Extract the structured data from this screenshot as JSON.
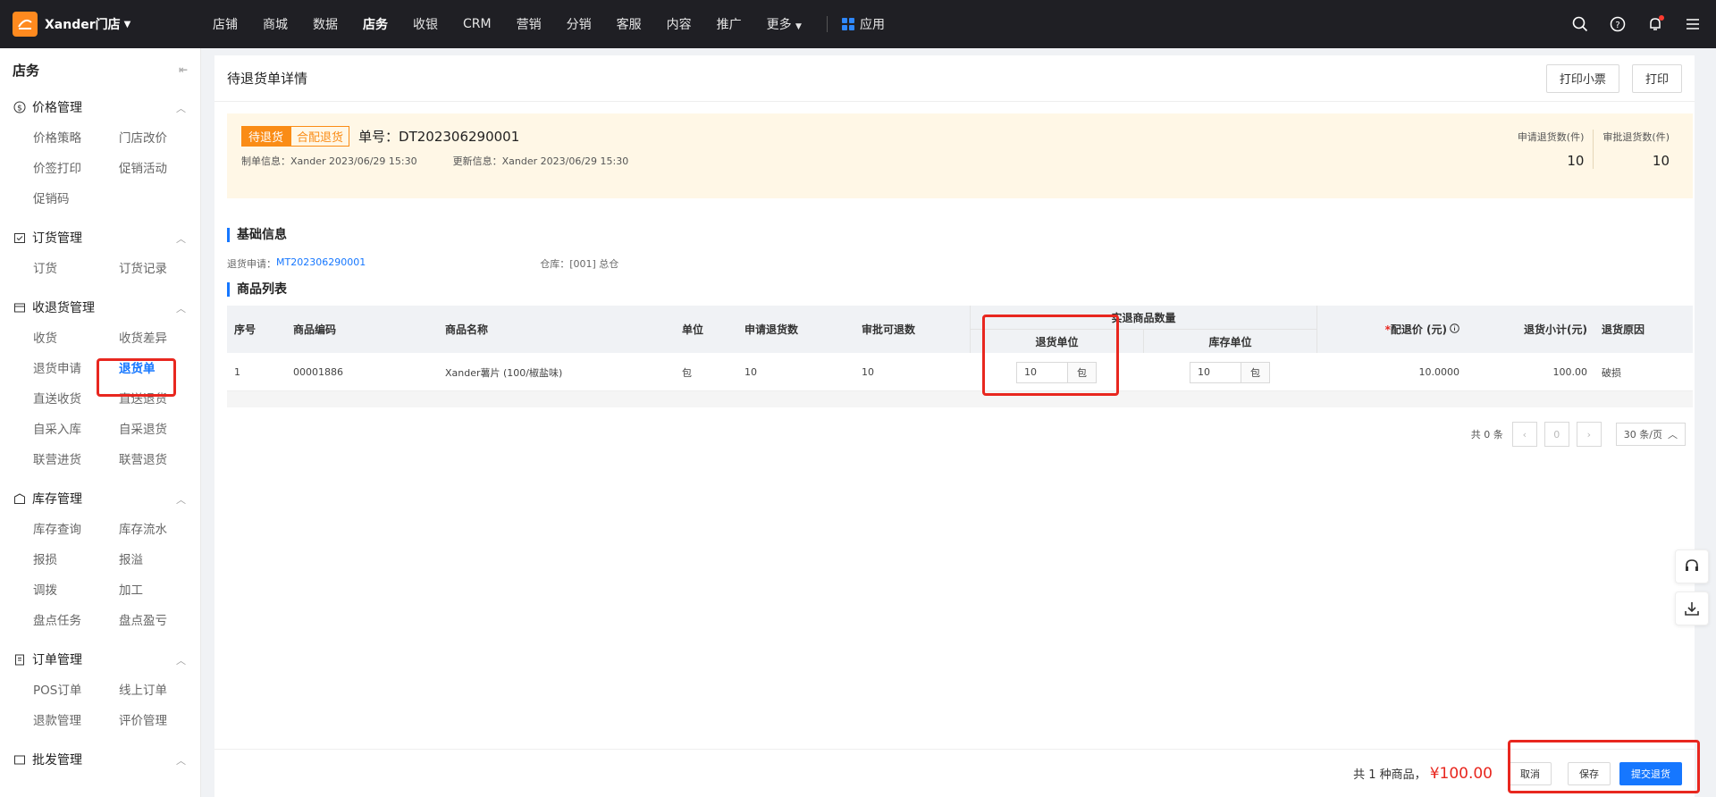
{
  "topbar": {
    "store": "Xander门店",
    "nav": [
      "店铺",
      "商城",
      "数据",
      "店务",
      "收银",
      "CRM",
      "营销",
      "分销",
      "客服",
      "内容",
      "推广",
      "更多"
    ],
    "active_nav": "店务",
    "app": "应用"
  },
  "sidebar": {
    "title": "店务",
    "groups": [
      {
        "title": "价格管理",
        "items": [
          "价格策略",
          "门店改价",
          "价签打印",
          "促销活动",
          "促销码"
        ]
      },
      {
        "title": "订货管理",
        "items": [
          "订货",
          "订货记录"
        ]
      },
      {
        "title": "收退货管理",
        "items": [
          "收货",
          "收货差异",
          "退货申请",
          "退货单",
          "直送收货",
          "直送退货",
          "自采入库",
          "自采退货",
          "联营进货",
          "联营退货"
        ]
      },
      {
        "title": "库存管理",
        "items": [
          "库存查询",
          "库存流水",
          "报损",
          "报溢",
          "调拨",
          "加工",
          "盘点任务",
          "盘点盈亏"
        ]
      },
      {
        "title": "订单管理",
        "items": [
          "POS订单",
          "线上订单",
          "退款管理",
          "评价管理"
        ]
      },
      {
        "title": "批发管理",
        "items": []
      }
    ],
    "active_item": "退货单"
  },
  "page": {
    "title": "待退货单详情",
    "print_receipt": "打印小票",
    "print": "打印"
  },
  "status": {
    "badge_status": "待退货",
    "badge_type": "合配退货",
    "order_no": "单号：DT202306290001",
    "created": "制单信息：Xander 2023/06/29 15:30",
    "updated": "更新信息：Xander 2023/06/29 15:30",
    "apply_label": "申请退货数(件)",
    "apply_value": "10",
    "approve_label": "审批退货数(件)",
    "approve_value": "10"
  },
  "basic": {
    "title": "基础信息",
    "apply_label": "退货申请：",
    "apply_link": "MT202306290001",
    "warehouse_label": "仓库：",
    "warehouse_value": "[001] 总仓"
  },
  "goods": {
    "title": "商品列表",
    "headers": {
      "seq": "序号",
      "code": "商品编码",
      "name": "商品名称",
      "unit": "单位",
      "apply": "申请退货数",
      "approve": "审批可退数",
      "actual_group": "实退商品数量",
      "return_unit": "退货单位",
      "stock_unit": "库存单位",
      "price": "配退价 (元)",
      "subtotal": "退货小计(元)",
      "reason": "退货原因"
    },
    "rows": [
      {
        "seq": "1",
        "code": "00001886",
        "name": "Xander薯片 (100/椒盐味)",
        "unit": "包",
        "apply": "10",
        "approve": "10",
        "ret_qty": "10",
        "ret_unit": "包",
        "stock_qty": "10",
        "stock_unit": "包",
        "price": "10.0000",
        "subtotal": "100.00",
        "reason": "破损"
      }
    ]
  },
  "pager": {
    "total": "共 0 条",
    "page": "0",
    "size": "30 条/页"
  },
  "footer": {
    "summary": "共 1 种商品，",
    "amount": "¥100.00",
    "cancel": "取消",
    "save": "保存",
    "submit": "提交退货"
  },
  "colors": {
    "accent": "#1677ff",
    "warning": "#fa8c16",
    "highlight": "#e8271f"
  }
}
